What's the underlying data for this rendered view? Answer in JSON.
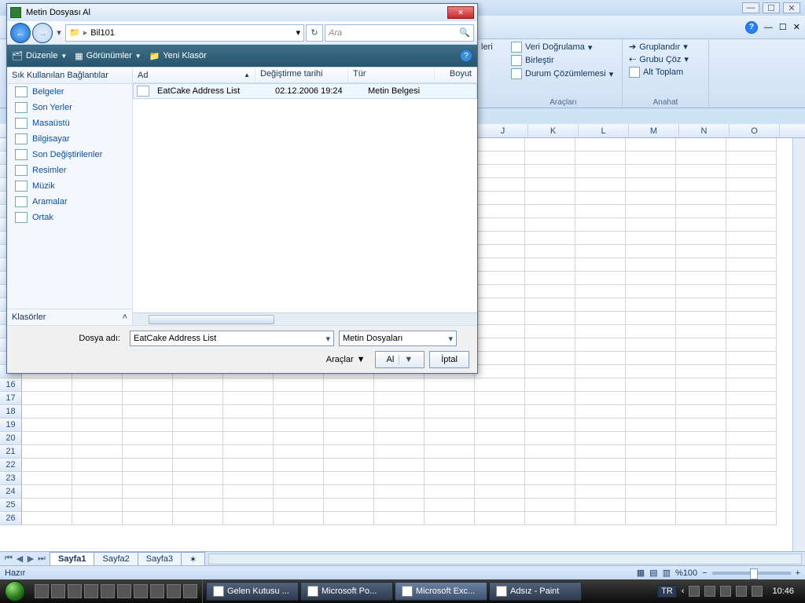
{
  "dialog": {
    "title": "Metin Dosyası Al",
    "breadcrumb": "Bil101",
    "search_placeholder": "Ara",
    "toolbar": {
      "organize": "Düzenle",
      "views": "Görünümler",
      "newfolder": "Yeni Klasör"
    },
    "favorites_header": "Sık Kullanılan Bağlantılar",
    "favorites": [
      "Belgeler",
      "Son Yerler",
      "Masaüstü",
      "Bilgisayar",
      "Son Değiştirilenler",
      "Resimler",
      "Müzik",
      "Aramalar",
      "Ortak"
    ],
    "folders_label": "Klasörler",
    "columns": {
      "name": "Ad",
      "date": "Değiştirme tarihi",
      "type": "Tür",
      "size": "Boyut"
    },
    "file": {
      "name": "EatCake Address List",
      "date": "02.12.2006 19:24",
      "type": "Metin Belgesi"
    },
    "filename_label": "Dosya adı:",
    "filename_value": "EatCake Address List",
    "filter_value": "Metin Dosyaları",
    "tools_label": "Araçlar",
    "open_label": "Al",
    "cancel_label": "İptal"
  },
  "ribbon": {
    "group1_label": "Araçları",
    "g1a": "Veri Doğrulama",
    "g1b": "Birleştir",
    "g1c": "Durum Çözümlemesi",
    "group2_label": "Anahat",
    "g2a": "Gruplandır",
    "g2b": "Grubu Çöz",
    "g2c": "Alt Toplam"
  },
  "grid": {
    "cols": [
      "J",
      "K",
      "L",
      "M",
      "N",
      "O"
    ],
    "rows_partial": [
      "16",
      "17",
      "18",
      "19",
      "20",
      "21",
      "22",
      "23",
      "24",
      "25",
      "26"
    ]
  },
  "sheets": {
    "s1": "Sayfa1",
    "s2": "Sayfa2",
    "s3": "Sayfa3"
  },
  "status": {
    "ready": "Hazır",
    "zoom": "%100"
  },
  "taskbar": {
    "t1": "Gelen Kutusu ...",
    "t2": "Microsoft Po...",
    "t3": "Microsoft Exc...",
    "t4": "Adsız - Paint",
    "lang": "TR",
    "clock": "10:46"
  },
  "trailing_label": "leri"
}
